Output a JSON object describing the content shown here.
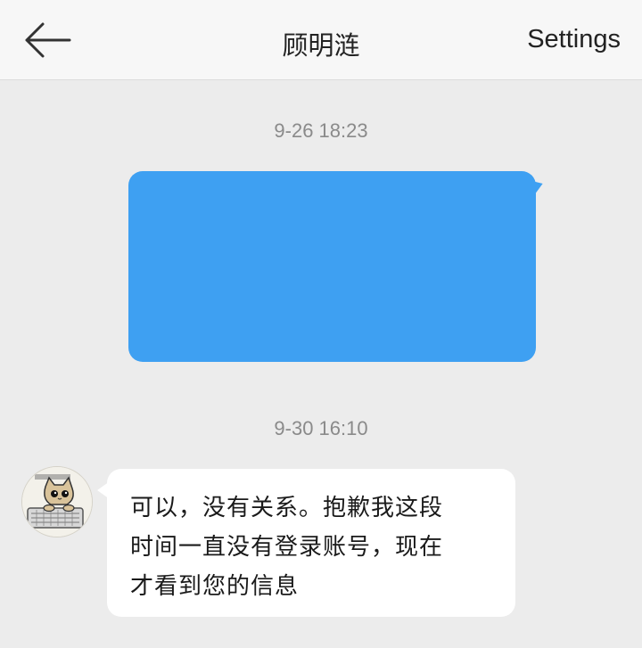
{
  "header": {
    "title": "顾明涟",
    "settings_label": "Settings"
  },
  "messages": [
    {
      "timestamp": "9-26 18:23",
      "direction": "sent",
      "text": ""
    },
    {
      "timestamp": "9-30 16:10",
      "direction": "received",
      "lines": [
        "可以，没有关系。抱歉我这段",
        "时间一直没有登录账号，现在",
        "才看到您的信息"
      ]
    }
  ],
  "colors": {
    "sent_bubble": "#3ea0f2",
    "received_bubble": "#ffffff",
    "background": "#ececec"
  },
  "icons": {
    "back": "arrow-left-icon"
  }
}
